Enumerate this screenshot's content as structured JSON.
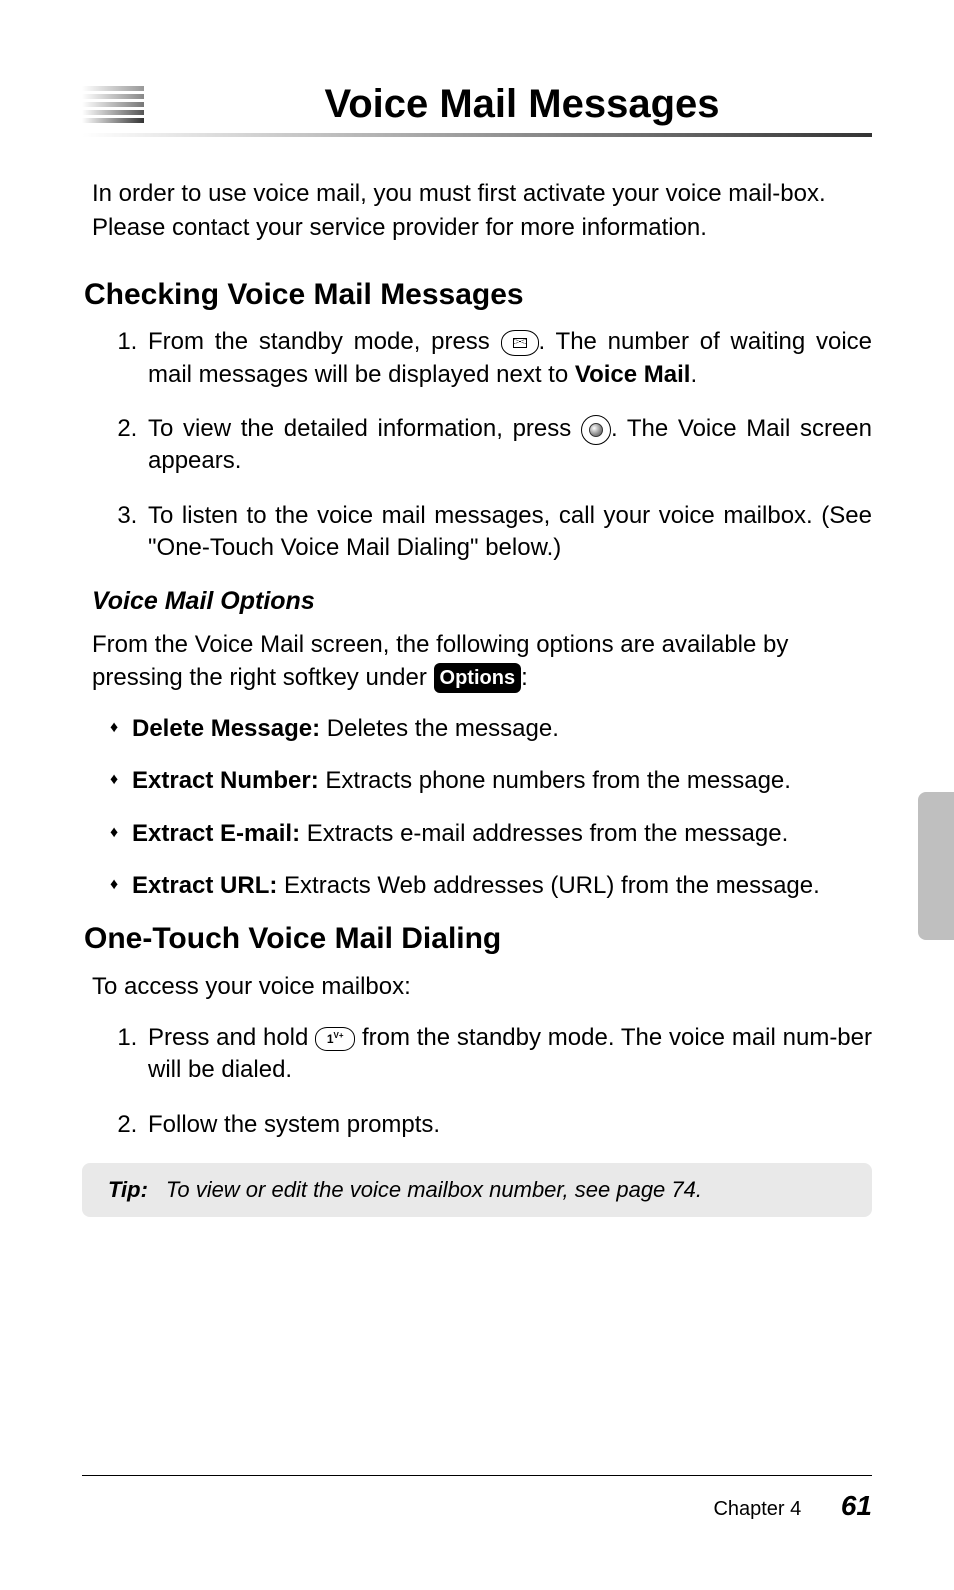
{
  "title": "Voice Mail Messages",
  "intro": "In order to use voice mail, you must first activate your voice mail-box. Please contact your service provider for more information.",
  "section1": {
    "heading": "Checking Voice Mail Messages",
    "steps": {
      "s1a": "From the standby mode, press ",
      "s1b": ". The number of waiting voice mail messages will be displayed next to ",
      "s1c": "Voice Mail",
      "s1d": ".",
      "s2a": "To view the detailed information, press ",
      "s2b": ". The Voice Mail screen appears.",
      "s3": "To listen to the voice mail messages, call your voice mailbox. (See \"One-Touch Voice Mail Dialing\" below.)"
    }
  },
  "subsection": {
    "heading": "Voice Mail Options",
    "intro_a": "From the Voice Mail screen, the following options are available by pressing the right softkey under ",
    "options_label": "Options",
    "intro_b": ":",
    "bullets": [
      {
        "term": "Delete Message:",
        "desc": " Deletes the message."
      },
      {
        "term": "Extract Number:",
        "desc": " Extracts phone numbers from the message."
      },
      {
        "term": "Extract E-mail:",
        "desc": " Extracts e-mail addresses from the message."
      },
      {
        "term": "Extract URL:",
        "desc": " Extracts Web addresses (URL) from the message."
      }
    ]
  },
  "section2": {
    "heading": "One-Touch Voice Mail Dialing",
    "intro": "To access your voice mailbox:",
    "steps": {
      "s1a": "Press and hold ",
      "s1b": " from the standby mode. The voice mail num-ber will be dialed.",
      "s2": "Follow the system prompts."
    }
  },
  "tip": {
    "label": "Tip:",
    "text": "To view or edit the voice mailbox number, see page 74."
  },
  "footer": {
    "chapter": "Chapter 4",
    "page": "61"
  },
  "icons": {
    "key1_main": "1",
    "key1_sup": "V+"
  }
}
